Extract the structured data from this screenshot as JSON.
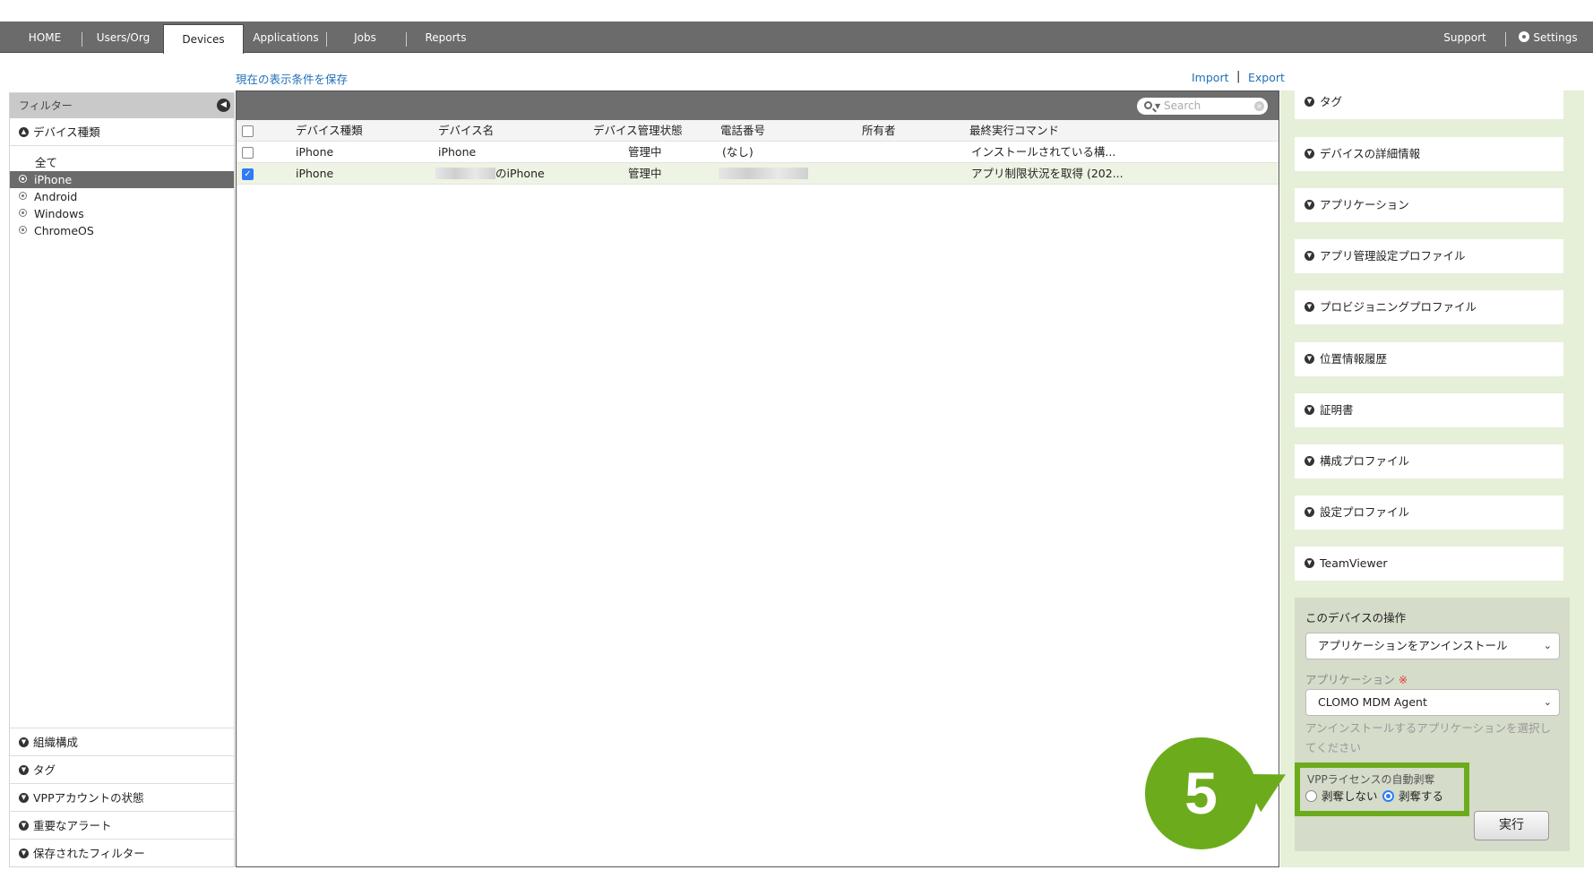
{
  "nav": {
    "items": [
      {
        "label": "HOME",
        "active": false
      },
      {
        "label": "Users/Org",
        "active": false
      },
      {
        "label": "Devices",
        "active": true
      },
      {
        "label": "Applications",
        "active": false
      },
      {
        "label": "Jobs",
        "active": false
      },
      {
        "label": "Reports",
        "active": false
      }
    ],
    "support": "Support",
    "settings": "Settings"
  },
  "links": {
    "save_view": "現在の表示条件を保存",
    "import": "Import",
    "separator": "|",
    "export": "Export"
  },
  "filter": {
    "title": "フィルター",
    "device_type_header": "デバイス種類",
    "items": [
      "全て",
      "iPhone",
      "Android",
      "Windows",
      "ChromeOS"
    ],
    "selected": "iPhone",
    "bottom_sections": [
      "組織構成",
      "タグ",
      "VPPアカウントの状態",
      "重要なアラート",
      "保存されたフィルター"
    ]
  },
  "grid": {
    "search_placeholder": "Search",
    "columns": [
      "デバイス種類",
      "デバイス名",
      "デバイス管理状態",
      "電話番号",
      "所有者",
      "最終実行コマンド"
    ],
    "rows": [
      {
        "checked": false,
        "type": "iPhone",
        "name": "iPhone",
        "status": "管理中",
        "phone": "(なし)",
        "owner": "",
        "last_command": "インストールされている構..."
      },
      {
        "checked": true,
        "type": "iPhone",
        "name": "のiPhone",
        "status": "管理中",
        "phone": "",
        "owner": "",
        "last_command": "アプリ制限状況を取得 (202..."
      }
    ]
  },
  "details": {
    "sections": [
      "タグ",
      "デバイスの詳細情報",
      "アプリケーション",
      "アプリ管理設定プロファイル",
      "プロビジョニングプロファイル",
      "位置情報履歴",
      "証明書",
      "構成プロファイル",
      "設定プロファイル",
      "TeamViewer"
    ],
    "operation": {
      "title": "このデバイスの操作",
      "action_value": "アプリケーションをアンインストール",
      "app_label": "アプリケーション",
      "required_mark": "※",
      "app_value": "CLOMO MDM Agent",
      "hint": "アンインストールするアプリケーションを選択してください",
      "vpp_label": "VPPライセンスの自動剥奪",
      "vpp_options": [
        "剥奪しない",
        "剥奪する"
      ],
      "vpp_selected": "剥奪する",
      "run_label": "実行"
    }
  },
  "step_marker": "5",
  "colors": {
    "nav_bg": "#6b6b6b",
    "accent_green": "#6cac1c",
    "link_blue": "#1f6fb8",
    "panel_green": "#e6efd8"
  }
}
